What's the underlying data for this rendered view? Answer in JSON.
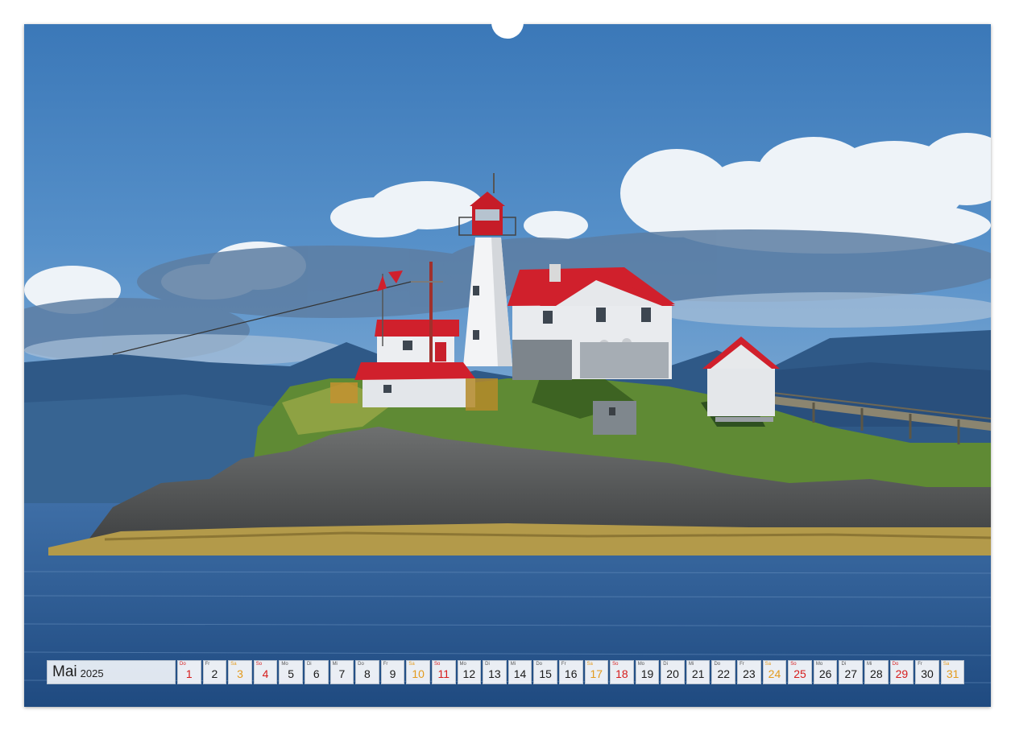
{
  "calendar": {
    "month": "Mai",
    "year": "2025",
    "days": [
      {
        "weekday": "Do",
        "day": "1",
        "type": "hol"
      },
      {
        "weekday": "Fr",
        "day": "2",
        "type": "weekday"
      },
      {
        "weekday": "Sa",
        "day": "3",
        "type": "sat"
      },
      {
        "weekday": "So",
        "day": "4",
        "type": "sun"
      },
      {
        "weekday": "Mo",
        "day": "5",
        "type": "weekday"
      },
      {
        "weekday": "Di",
        "day": "6",
        "type": "weekday"
      },
      {
        "weekday": "Mi",
        "day": "7",
        "type": "weekday"
      },
      {
        "weekday": "Do",
        "day": "8",
        "type": "weekday"
      },
      {
        "weekday": "Fr",
        "day": "9",
        "type": "weekday"
      },
      {
        "weekday": "Sa",
        "day": "10",
        "type": "sat"
      },
      {
        "weekday": "So",
        "day": "11",
        "type": "sun"
      },
      {
        "weekday": "Mo",
        "day": "12",
        "type": "weekday"
      },
      {
        "weekday": "Di",
        "day": "13",
        "type": "weekday"
      },
      {
        "weekday": "Mi",
        "day": "14",
        "type": "weekday"
      },
      {
        "weekday": "Do",
        "day": "15",
        "type": "weekday"
      },
      {
        "weekday": "Fr",
        "day": "16",
        "type": "weekday"
      },
      {
        "weekday": "Sa",
        "day": "17",
        "type": "sat"
      },
      {
        "weekday": "So",
        "day": "18",
        "type": "sun"
      },
      {
        "weekday": "Mo",
        "day": "19",
        "type": "weekday"
      },
      {
        "weekday": "Di",
        "day": "20",
        "type": "weekday"
      },
      {
        "weekday": "Mi",
        "day": "21",
        "type": "weekday"
      },
      {
        "weekday": "Do",
        "day": "22",
        "type": "weekday"
      },
      {
        "weekday": "Fr",
        "day": "23",
        "type": "weekday"
      },
      {
        "weekday": "Sa",
        "day": "24",
        "type": "sat"
      },
      {
        "weekday": "So",
        "day": "25",
        "type": "sun"
      },
      {
        "weekday": "Mo",
        "day": "26",
        "type": "weekday"
      },
      {
        "weekday": "Di",
        "day": "27",
        "type": "weekday"
      },
      {
        "weekday": "Mi",
        "day": "28",
        "type": "weekday"
      },
      {
        "weekday": "Do",
        "day": "29",
        "type": "hol"
      },
      {
        "weekday": "Fr",
        "day": "30",
        "type": "weekday"
      },
      {
        "weekday": "Sa",
        "day": "31",
        "type": "sat"
      }
    ]
  },
  "colors": {
    "saturday": "#e39a1c",
    "sunday_holiday": "#d61c1c",
    "roof_red": "#d0202c",
    "sky": "#4a86c4",
    "sea": "#2e5d94"
  }
}
